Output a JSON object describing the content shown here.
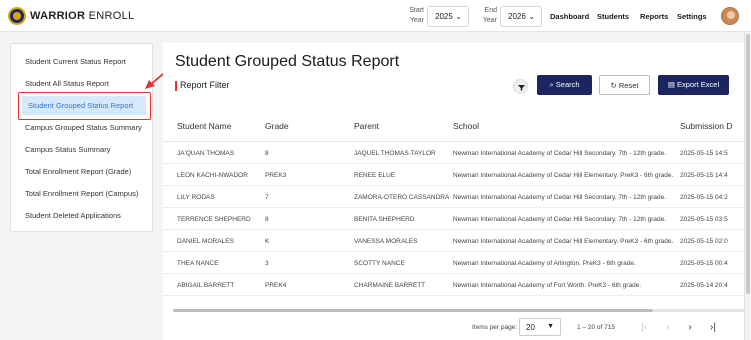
{
  "app": {
    "brand_bold": "WARRIOR",
    "brand_rest": " ENROLL"
  },
  "header": {
    "start_year_label_1": "Start",
    "start_year_label_2": "Year",
    "start_year_value": "2025",
    "end_year_label_1": "End",
    "end_year_label_2": "Year",
    "end_year_value": "2026",
    "nav": [
      "Dashboard",
      "Students",
      "Reports",
      "Settings"
    ]
  },
  "sidebar": {
    "items": [
      "Student Current Status Report",
      "Student All Status Report",
      "Student Grouped Status Report",
      "Campus Grouped Status Summary",
      "Campus Status Summary",
      "Total Enrollment Report (Grade)",
      "Total Enrollment Report (Campus)",
      "Student Deleted Applications"
    ],
    "active_index": 2
  },
  "main": {
    "title": "Student Grouped Status Report",
    "filter_label": "Report Filter",
    "buttons": {
      "search": "Search",
      "reset": "Reset",
      "export": "Export Excel"
    },
    "columns": [
      "Student Name",
      "Grade",
      "Parent",
      "School",
      "Submission D"
    ],
    "rows": [
      {
        "name": "JA'QUAN THOMAS",
        "grade": "8",
        "parent": "JAQUEL THOMAS-TAYLOR",
        "school": "Newman International Academy of Cedar Hill Secondary. 7th - 12th grade.",
        "date": "2025-05-15 14:5"
      },
      {
        "name": "LEON KACHI-NWADOR",
        "grade": "PREK3",
        "parent": "RENEE ELUE",
        "school": "Newman International Academy of Cedar Hill Elementary. PreK3 - 6th grade.",
        "date": "2025-05-15 14:4"
      },
      {
        "name": "LILY RODAS",
        "grade": "7",
        "parent": "ZAMORA-OTERO CASSANDRA",
        "school": "Newman International Academy of Cedar Hill Secondary. 7th - 12th grade.",
        "date": "2025-05-15 04:2"
      },
      {
        "name": "TERRENCE SHEPHERD",
        "grade": "8",
        "parent": "BENITA SHEPHERD",
        "school": "Newman International Academy of Cedar Hill Secondary. 7th - 12th grade.",
        "date": "2025-05-15 03:5"
      },
      {
        "name": "DANIEL MORALES",
        "grade": "K",
        "parent": "VANESSA MORALES",
        "school": "Newman International Academy of Cedar Hill Elementary. PreK3 - 6th grade.",
        "date": "2025-05-15 02:0"
      },
      {
        "name": "THEA NANCE",
        "grade": "3",
        "parent": "SCOTTY NANCE",
        "school": "Newman International Academy of Arlington. PreK3 - 6th grade.",
        "date": "2025-05-15 00:4"
      },
      {
        "name": "ABIGAIL BARRETT",
        "grade": "PREK4",
        "parent": "CHARMAINE BARRETT",
        "school": "Newman International Academy of Fort Worth. PreK3 - 6th grade.",
        "date": "2025-05-14 20:4"
      }
    ],
    "pagination": {
      "items_per_page_label": "Items per page:",
      "items_per_page_value": "20",
      "range": "1 – 20 of 715"
    }
  },
  "colors": {
    "primary": "#1b2560",
    "accent_red": "#e2332f",
    "active_bg": "#d6e9fb",
    "active_text": "#3577c8"
  },
  "icons": {
    "filter": "filter-icon",
    "search": "search-icon",
    "reset": "refresh-icon",
    "export": "file-icon",
    "chevron": "chevron-down-icon",
    "first": "first-page-icon",
    "prev": "prev-page-icon",
    "next": "next-page-icon",
    "last": "last-page-icon"
  }
}
